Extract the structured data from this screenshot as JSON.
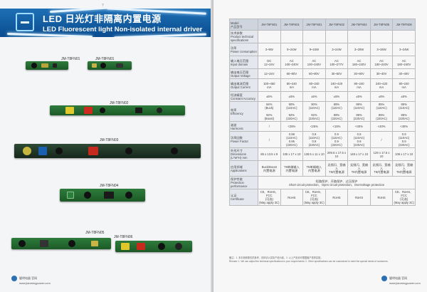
{
  "left_page": {
    "page_number": "7",
    "title_cn": "LED 日光灯非隔离内置电源",
    "title_en": "LED Fluorescent light Non-isolated internal driver",
    "products": [
      "JM-T8FN01",
      "JM-T8FN01",
      "JM-T8FN02",
      "JM-T8FN03",
      "JM-T8FN04",
      "JM-T8FN05",
      "JM-T8FN06"
    ],
    "footer": {
      "company": "健明电器 官网",
      "site": "www.jianmingpower.com"
    }
  },
  "right_page": {
    "table": {
      "model_header": "Model\n产品型号",
      "models": [
        "JM-T8FN01",
        "JM-T8FN01",
        "JM-T8FN01",
        "JM-T8FN02",
        "JM-T8FN04",
        "JM-T8FN05",
        "JM-T8FN06"
      ],
      "rows": [
        {
          "label": "技术参数\nProduct technical specifications",
          "cells": [
            "",
            "",
            "",
            "",
            "",
            "",
            ""
          ]
        },
        {
          "label": "功率\nPower consumption",
          "cells": [
            "3~9W",
            "9~24W",
            "9~24W",
            "3~24W",
            "3~20W",
            "3~36W",
            "3~24W"
          ]
        },
        {
          "label": "输入电压范围\nInput domain",
          "cells": [
            "DC\n12~24V",
            "AC\n100~240V",
            "AC\n100~240V",
            "AC\n100~277V",
            "AC\n180~240V",
            "AC\n180~240V",
            "AC\n180~240V"
          ]
        },
        {
          "label": "输出电压范围\nOutput Voltage",
          "cells": [
            "12~24V",
            "60~80V",
            "60~80V",
            "30~50V",
            "30~80V",
            "30~40V",
            "30~40V"
          ]
        },
        {
          "label": "输出电流范围\nOutput Current",
          "cells": [
            "100~450\nmA",
            "80~240\nmA",
            "80~240\nmA",
            "240~420\nmA",
            "80~240\nmA",
            "240~420\nmA",
            "80~240\nmA"
          ]
        },
        {
          "label": "恒流精度\nConstant Accuracy",
          "cells": [
            "±5%",
            "±5%",
            "±5%",
            "±5%",
            "±5%",
            "±5%",
            "±5%"
          ]
        },
        {
          "label": "效率\nEfficiency",
          "cells": [
            "84%\n(Buck)\n\n92%\n(Boost)",
            "90%\n(110AC)\n\n92%\n(220AC)",
            "90%\n(110AC)\n\n92%\n(220AC)",
            "89%\n(110AC)\n\n89%\n(220AC)",
            "89%\n(110AC)\n\n89%\n(220AC)",
            "85%\n(110AC)\n\n85%\n(220AC)",
            "85%\n(110AC)\n\n85%\n(220AC)"
          ]
        },
        {
          "label": "谐波\nHarmonic",
          "cells": [
            "/",
            "<25%",
            "<25%",
            "<15%",
            "<40%",
            "<40%",
            "<40%"
          ]
        },
        {
          "label": "功率因数\nPower Factor",
          "cells": [
            "/",
            "0.98\n(110AC)\n0.95\n(220AC)",
            "0.9\n(110AC)\n0.9\n(220AC)",
            "0.9\n(110AC)\n0.9\n(220AC)",
            "0.9\n(110AC)\n0.9\n(220AC)",
            "/",
            "0.9\n(110AC)\n0.9\n(220AC)"
          ]
        },
        {
          "label": "外形尺寸\nDimensions\n(L*W*H) mm",
          "cells": [
            "85 x 13.5 x 9",
            "105 x 17 x 10",
            "128.5 x 11 x 10",
            "209.5 x 17.5 x 10",
            "148 x 17 x 10",
            "129 x 17.5 x 10",
            "106 x 17 x 10"
          ]
        },
        {
          "label": "应用领域\nApplications",
          "cells": [
            "Buck/Boost\n内置电源",
            "T8单端输入\n内置电源",
            "T8单端输入\n内置电源",
            "无频闪、宽输入\nT8内置电源",
            "无频闪、宽输入\nT8内置电源",
            "无频闪、宽输入\nT8内置电源",
            "无频闪、宽输入\nT8内置电源"
          ]
        },
        {
          "label": "保护性能\nProtection performance",
          "wide": "短路保护、开路保护、过压保护\nShort circuit protection、Open circuit protection、Overvoltage protection"
        },
        {
          "label": "认证\nCertificate",
          "cells": [
            "CE、RoHS、FCC\n(可选)\n(May apply 3C)",
            "RoHS",
            "CE、RoHS、FCC\n(可选)\n(May apply 3C)",
            "RoHS",
            "RoHS",
            "RoHS",
            "CE、RoHS、FCC\n(可选)\n(May apply 3C)"
          ]
        }
      ]
    },
    "notes": [
      "备注：1. 本手册参数仅供参考，具体请以实际产品为准。2. 以上产品也可根据客户需求定制。",
      "Remark: 1. We can adjust the technical specifications to your requirements. 2. Other specifications can be customized to meet the special needs of customers."
    ],
    "footer": {
      "company": "健明电器 官网",
      "site": "www.jianmingpower.com"
    }
  }
}
